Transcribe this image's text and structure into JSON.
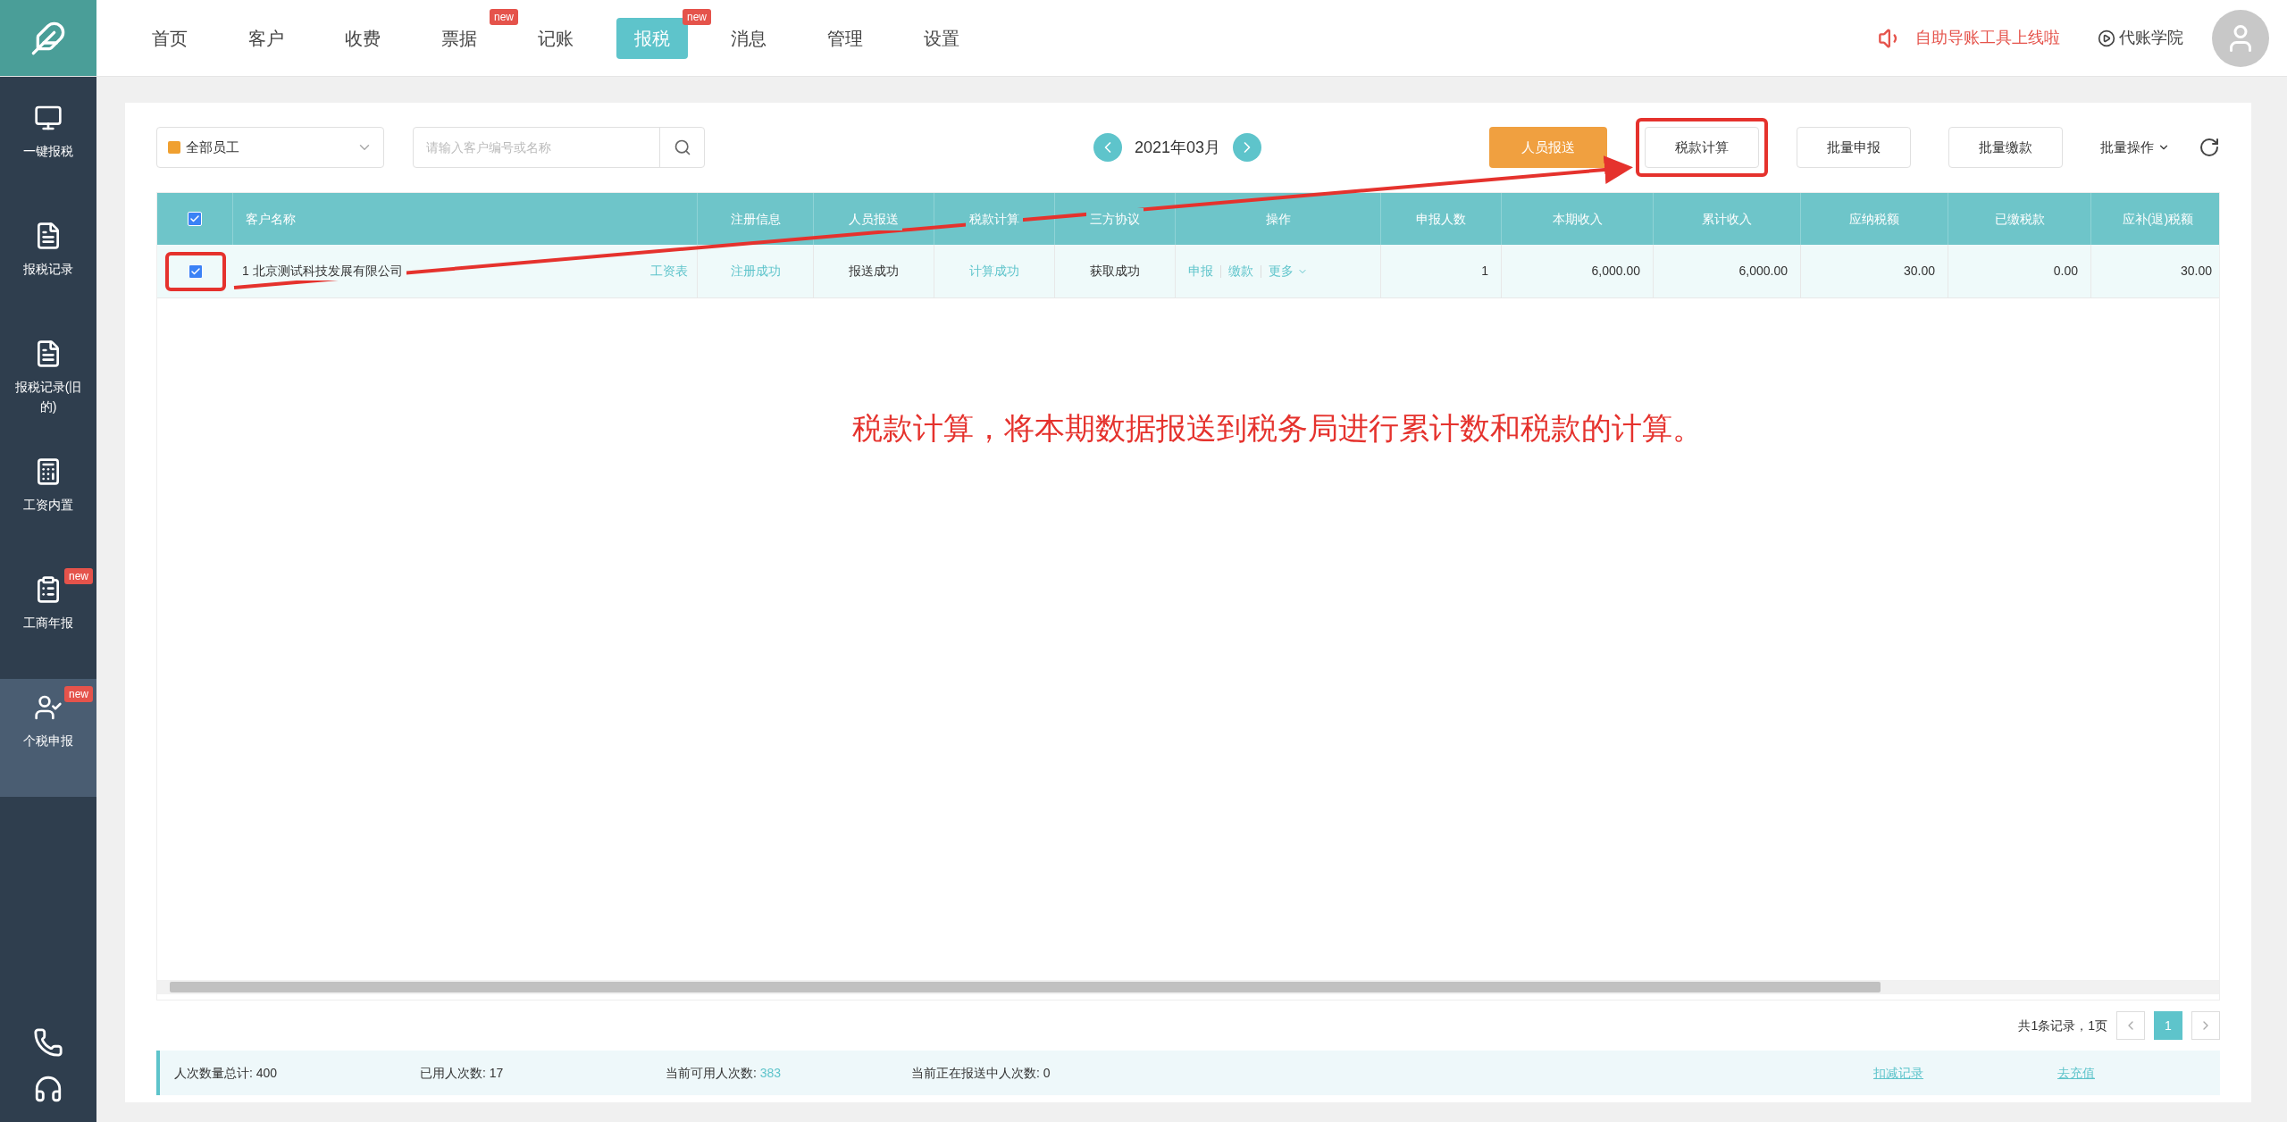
{
  "nav": {
    "items": [
      {
        "label": "首页",
        "selected": false
      },
      {
        "label": "客户",
        "selected": false
      },
      {
        "label": "收费",
        "selected": false
      },
      {
        "label": "票据",
        "selected": false,
        "badge": "new"
      },
      {
        "label": "记账",
        "selected": false
      },
      {
        "label": "报税",
        "selected": true,
        "badge": "new"
      },
      {
        "label": "消息",
        "selected": false
      },
      {
        "label": "管理",
        "selected": false
      },
      {
        "label": "设置",
        "selected": false
      }
    ],
    "notice": "自助导账工具上线啦",
    "academy": "代账学院"
  },
  "sidebar": {
    "items": [
      {
        "label": "一键报税",
        "selected": false
      },
      {
        "label": "报税记录",
        "selected": false
      },
      {
        "label": "报税记录(旧的)",
        "selected": false
      },
      {
        "label": "工资内置",
        "selected": false
      },
      {
        "label": "工商年报",
        "selected": false,
        "badge": "new"
      },
      {
        "label": "个税申报",
        "selected": true,
        "badge": "new"
      }
    ]
  },
  "toolbar": {
    "staff": "全部员工",
    "search": {
      "placeholder": "请输入客户编号或名称"
    },
    "period": "2021年03月",
    "buttons": [
      {
        "label": "人员报送",
        "kind": "primary",
        "highlighted": false
      },
      {
        "label": "税款计算",
        "kind": "outline",
        "highlighted": true
      },
      {
        "label": "批量申报",
        "kind": "outline",
        "highlighted": false
      },
      {
        "label": "批量缴款",
        "kind": "outline",
        "highlighted": false
      },
      {
        "label": "批量操作",
        "kind": "menu",
        "highlighted": false
      }
    ]
  },
  "table": {
    "all_checked": true,
    "columns": [
      "客户名称",
      "注册信息",
      "人员报送",
      "税款计算",
      "三方协议",
      "操作",
      "申报人数",
      "本期收入",
      "累计收入",
      "应纳税额",
      "已缴税款",
      "应补(退)税额"
    ],
    "rows": [
      {
        "checked": true,
        "highlighted": true,
        "cells": [
          {
            "kind": "name",
            "text": "1 北京测试科技发展有限公司",
            "link": "工资表"
          },
          {
            "kind": "link",
            "text": "注册成功"
          },
          {
            "kind": "text",
            "text": "报送成功"
          },
          {
            "kind": "link",
            "text": "计算成功"
          },
          {
            "kind": "text",
            "text": "获取成功"
          },
          {
            "kind": "actions",
            "actions": [
              "申报",
              "缴款",
              "更多"
            ]
          },
          {
            "kind": "number",
            "text": "1"
          },
          {
            "kind": "number",
            "text": "6,000.00"
          },
          {
            "kind": "number",
            "text": "6,000.00"
          },
          {
            "kind": "number",
            "text": "30.00"
          },
          {
            "kind": "number",
            "text": "0.00"
          },
          {
            "kind": "number",
            "text": "30.00"
          }
        ]
      }
    ]
  },
  "annotation": "税款计算，将本期数据报送到税务局进行累计数和税款的计算。",
  "pagination": {
    "summary": "共1条记录，1页",
    "pages": [
      {
        "label": "1",
        "selected": true
      }
    ]
  },
  "footer": {
    "stats": [
      {
        "label": "人次数量总计: ",
        "value": "400",
        "kind": "plain"
      },
      {
        "label": "已用人次数: ",
        "value": "17",
        "kind": "plain"
      },
      {
        "label": "当前可用人次数: ",
        "value": "383",
        "kind": "link"
      },
      {
        "label": "当前正在报送中人次数: ",
        "value": "0",
        "kind": "plain"
      }
    ],
    "links": [
      "扣减记录",
      "去充值"
    ]
  }
}
